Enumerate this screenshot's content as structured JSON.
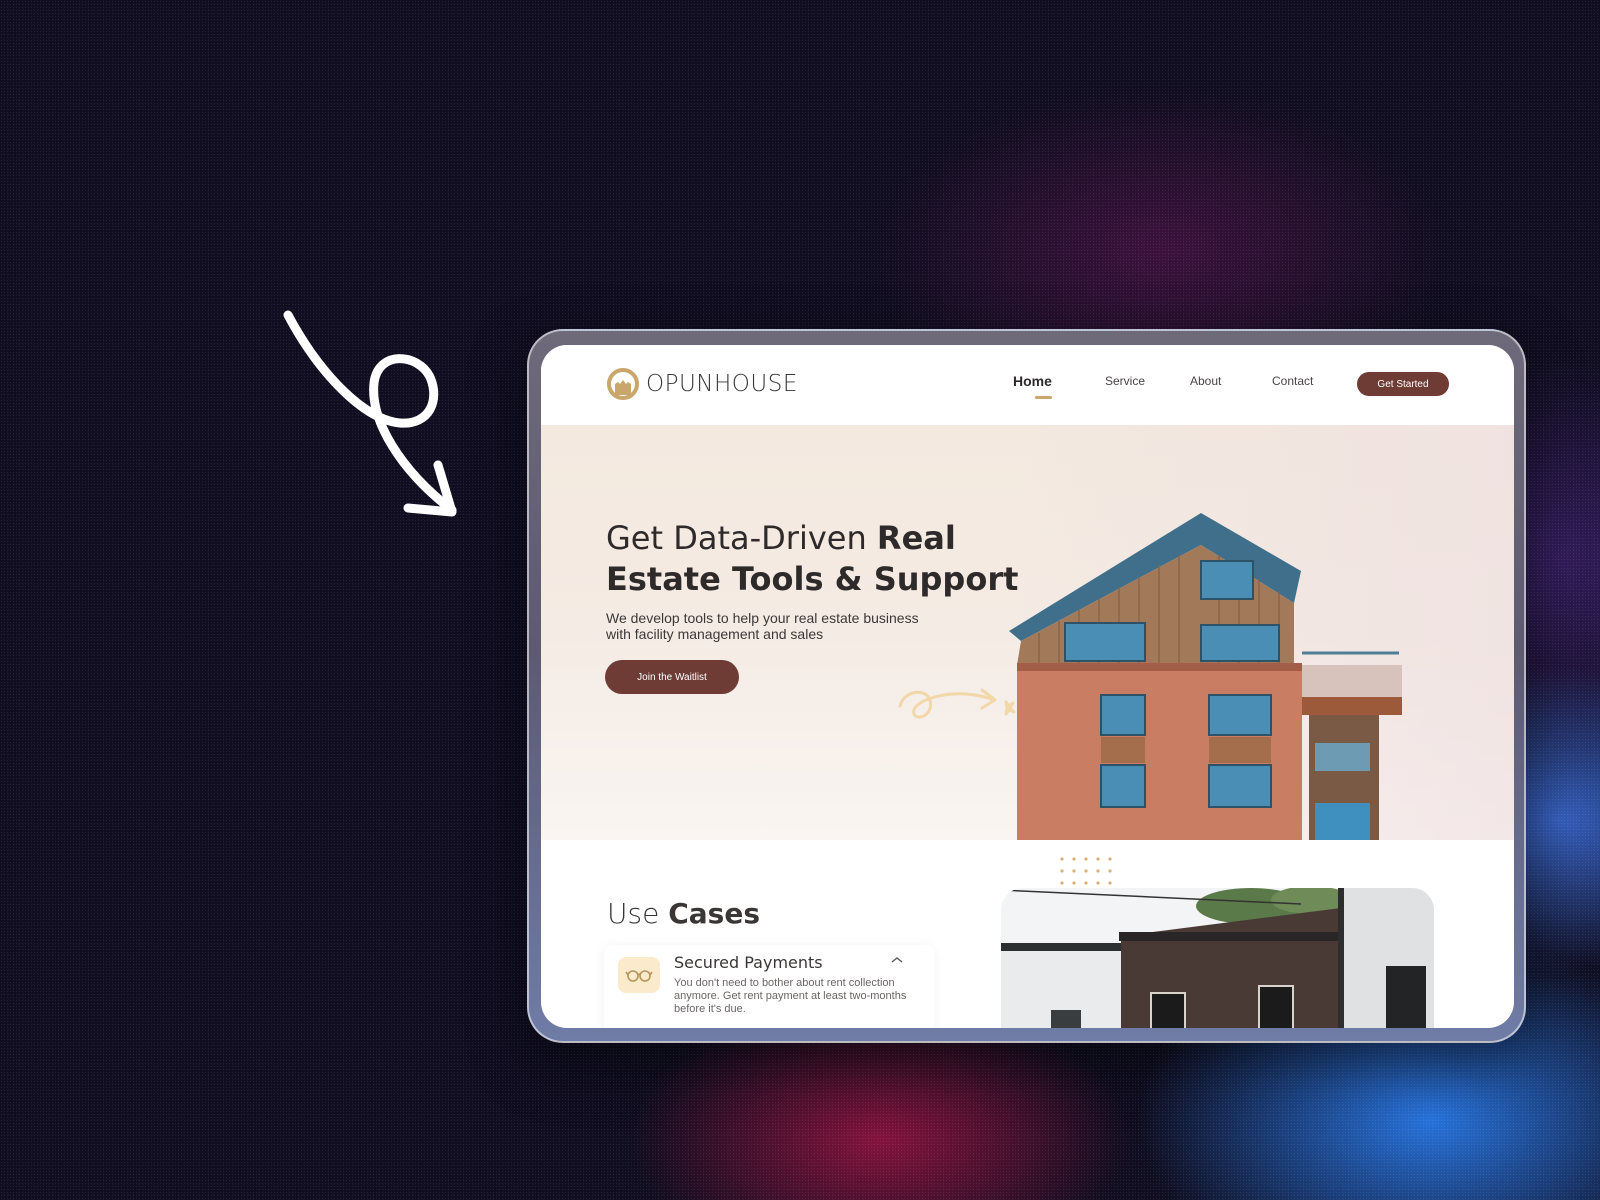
{
  "brand": {
    "name": "OPUNHOUSE",
    "accent": "#c9a66b",
    "primary": "#6e3b35"
  },
  "nav": {
    "items": [
      {
        "label": "Home",
        "active": true
      },
      {
        "label": "Service",
        "active": false
      },
      {
        "label": "About",
        "active": false
      },
      {
        "label": "Contact",
        "active": false
      }
    ],
    "cta_label": "Get Started"
  },
  "hero": {
    "title_light": "Get Data-Driven ",
    "title_bold_1": "Real",
    "title_bold_2": "Estate Tools & Support",
    "subtitle": "We develop tools to help your real estate business with facility management and sales",
    "cta_label": "Join the Waitlist"
  },
  "use_cases": {
    "title_light": "Use ",
    "title_bold": "Cases",
    "card": {
      "icon": "glasses-icon",
      "title": "Secured Payments",
      "text": "You don't need to bother about rent collection anymore. Get rent payment at least two-months before it's due."
    }
  }
}
